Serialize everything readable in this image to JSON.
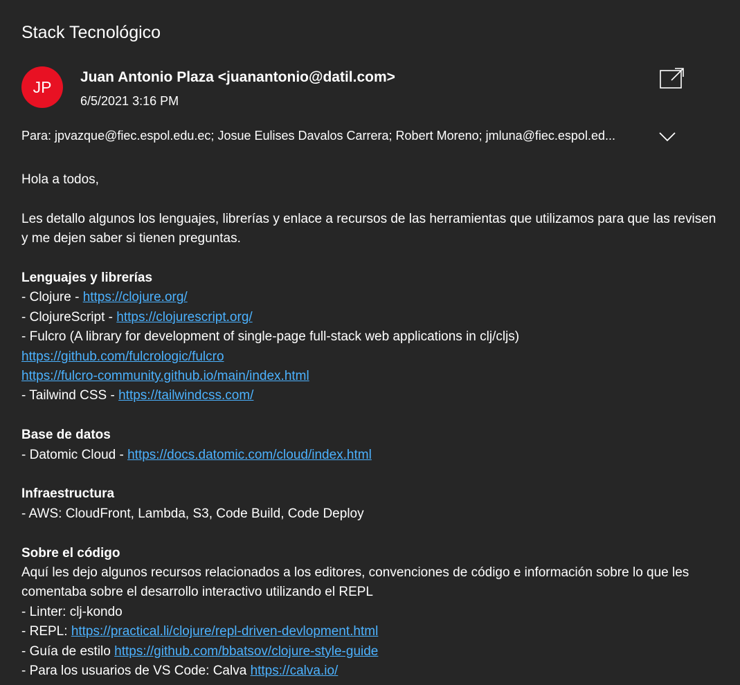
{
  "subject": "Stack Tecnológico",
  "sender": {
    "initials": "JP",
    "display": "Juan Antonio Plaza <juanantonio@datil.com>",
    "date": "6/5/2021 3:16 PM",
    "avatar_color": "#e81123"
  },
  "recipients": "Para: jpvazque@fiec.espol.edu.ec; Josue Eulises Davalos Carrera; Robert Moreno; jmluna@fiec.espol.ed...",
  "icons": {
    "popout": "open-in-new-window-icon",
    "expand": "chevron-down-icon"
  },
  "colors": {
    "background": "#262626",
    "link": "#4cb2ff",
    "text": "#ffffff"
  },
  "body": {
    "greeting": "Hola a todos,",
    "intro": "Les detallo algunos los lenguajes, librerías y enlace a recursos de las herramientas que utilizamos para que las revisen y me dejen saber si tienen preguntas.",
    "languages": {
      "heading": "Lenguajes y librerías",
      "clojure_prefix": "- Clojure - ",
      "clojure_link": "https://clojure.org/",
      "cljs_prefix": "- ClojureScript - ",
      "cljs_link": "https://clojurescript.org/",
      "fulcro_text": "- Fulcro (A library for development of single-page full-stack web applications in clj/cljs)",
      "fulcro_link1": "https://github.com/fulcrologic/fulcro",
      "fulcro_link2": "https://fulcro-community.github.io/main/index.html",
      "tailwind_prefix": "- Tailwind CSS - ",
      "tailwind_link": "https://tailwindcss.com/"
    },
    "database": {
      "heading": "Base de datos",
      "datomic_prefix": "- Datomic Cloud - ",
      "datomic_link": "https://docs.datomic.com/cloud/index.html"
    },
    "infra": {
      "heading": "Infraestructura",
      "aws": "- AWS: CloudFront, Lambda, S3, Code Build, Code Deploy"
    },
    "code": {
      "heading": "Sobre el código",
      "desc": "Aquí les dejo algunos recursos relacionados a los editores, convenciones de código e información sobre lo que les comentaba sobre el desarrollo interactivo utilizando el REPL",
      "linter": "- Linter: clj-kondo",
      "repl_prefix": "- REPL: ",
      "repl_link": "https://practical.li/clojure/repl-driven-devlopment.html",
      "style_prefix": "- Guía de estilo ",
      "style_link": "https://github.com/bbatsov/clojure-style-guide",
      "vscode_prefix": "- Para los usuarios de VS Code: Calva ",
      "vscode_link": "https://calva.io/"
    }
  }
}
